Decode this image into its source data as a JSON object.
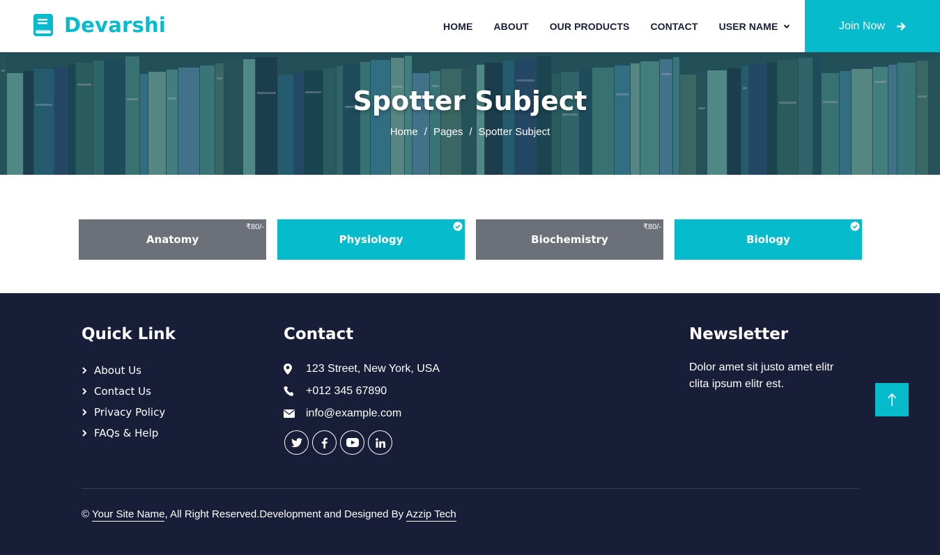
{
  "brand": {
    "name": "Devarshi",
    "color": "#06BBCC"
  },
  "nav": {
    "items": [
      "HOME",
      "ABOUT",
      "OUR PRODUCTS",
      "CONTACT",
      "USER NAME"
    ],
    "join_label": "Join Now"
  },
  "hero": {
    "title": "Spotter Subject",
    "breadcrumb": [
      "Home",
      "Pages",
      "Spotter Subject"
    ],
    "separator": "/"
  },
  "subjects": [
    {
      "name": "Anatomy",
      "price": "₹80/-",
      "selected": false
    },
    {
      "name": "Physiology",
      "price": "",
      "selected": true
    },
    {
      "name": "Biochemistry",
      "price": "₹80/-",
      "selected": false
    },
    {
      "name": "Biology",
      "price": "",
      "selected": true
    }
  ],
  "footer": {
    "quick_link": {
      "title": "Quick Link",
      "items": [
        "About Us",
        "Contact Us",
        "Privacy Policy",
        "FAQs & Help"
      ]
    },
    "contact": {
      "title": "Contact",
      "address": "123 Street, New York, USA",
      "phone": "+012 345 67890",
      "email": "info@example.com",
      "socials": [
        "twitter-icon",
        "facebook-icon",
        "youtube-icon",
        "linkedin-icon"
      ]
    },
    "newsletter": {
      "title": "Newsletter",
      "text": "Dolor amet sit justo amet elitr clita ipsum elitr est."
    },
    "copyright": {
      "symbol": "©",
      "site_name": "Your Site Name",
      "middle": ", All Right Reserved.Development and Designed By ",
      "designer": "Azzip Tech"
    }
  },
  "colors": {
    "accent": "#06BBCC",
    "dark": "#181d38",
    "card_gray": "#6c7078"
  }
}
